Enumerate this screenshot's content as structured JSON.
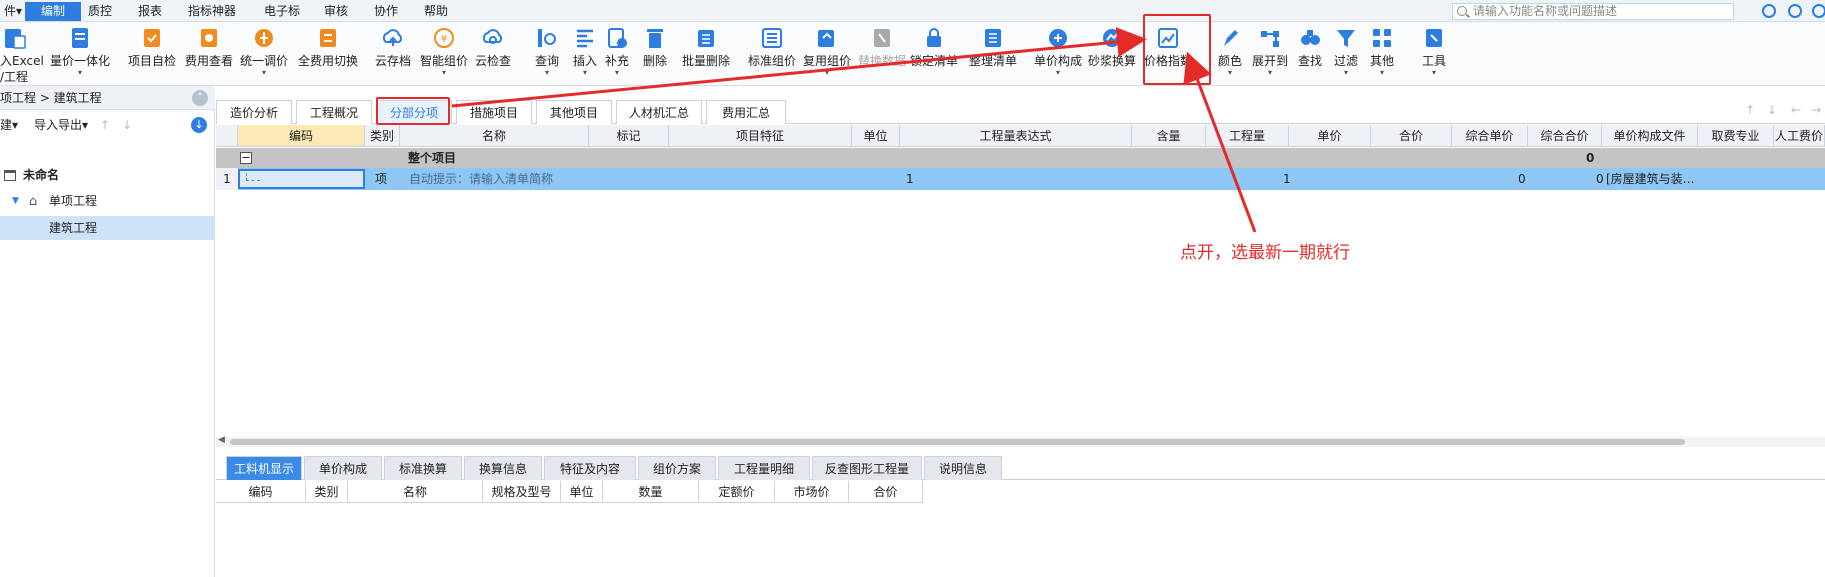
{
  "menu": {
    "items": [
      "件▾",
      "编制",
      "质控",
      "报表",
      "指标神器",
      "电子标",
      "审核",
      "协作",
      "帮助"
    ],
    "active": "编制"
  },
  "search": {
    "placeholder": "请输入功能名称或问题描述"
  },
  "toolbar": {
    "buttons": [
      {
        "label": "入Excel",
        "label2": "/工程",
        "icon": "import-icon",
        "color": "#2e7de0"
      },
      {
        "label": "量价一体化",
        "icon": "integration-icon",
        "color": "#2e7de0"
      },
      {
        "label": "项目自检",
        "icon": "check-icon",
        "color": "#f08c1e"
      },
      {
        "label": "费用查看",
        "icon": "fee-view-icon",
        "color": "#f08c1e"
      },
      {
        "label": "统一调价",
        "icon": "price-adjust-icon",
        "color": "#f08c1e"
      },
      {
        "label": "全费用切换",
        "icon": "switch-icon",
        "color": "#f08c1e"
      },
      {
        "label": "云存档",
        "icon": "cloud-save-icon",
        "color": "#2e7de0"
      },
      {
        "label": "智能组价",
        "icon": "smart-price-icon",
        "color": "#f08c1e"
      },
      {
        "label": "云检查",
        "icon": "cloud-check-icon",
        "color": "#2e7de0"
      },
      {
        "label": "查询",
        "icon": "query-icon",
        "color": "#2e7de0"
      },
      {
        "label": "插入",
        "icon": "insert-icon",
        "color": "#2e7de0"
      },
      {
        "label": "补充",
        "icon": "supplement-icon",
        "color": "#2e7de0"
      },
      {
        "label": "删除",
        "icon": "delete-icon",
        "color": "#2e7de0"
      },
      {
        "label": "批量删除",
        "icon": "batch-delete-icon",
        "color": "#2e7de0"
      },
      {
        "label": "标准组价",
        "icon": "standard-price-icon",
        "color": "#2e7de0"
      },
      {
        "label": "复用组价",
        "icon": "reuse-price-icon",
        "color": "#2e7de0"
      },
      {
        "label": "替换数据",
        "icon": "replace-icon",
        "color": "#aaaaaa"
      },
      {
        "label": "锁定清单",
        "icon": "lock-icon",
        "color": "#2e7de0"
      },
      {
        "label": "整理清单",
        "icon": "organize-icon",
        "color": "#2e7de0"
      },
      {
        "label": "单价构成",
        "icon": "unit-price-icon",
        "color": "#2e7de0"
      },
      {
        "label": "砂浆换算",
        "icon": "mortar-icon",
        "color": "#2e7de0"
      },
      {
        "label": "价格指数",
        "icon": "price-index-icon",
        "color": "#2e7de0"
      },
      {
        "label": "颜色",
        "icon": "color-icon",
        "color": "#2e7de0"
      },
      {
        "label": "展开到",
        "icon": "expand-icon",
        "color": "#2e7de0"
      },
      {
        "label": "查找",
        "icon": "find-icon",
        "color": "#2e7de0"
      },
      {
        "label": "过滤",
        "icon": "filter-icon",
        "color": "#2e7de0"
      },
      {
        "label": "其他",
        "icon": "other-icon",
        "color": "#2e7de0"
      },
      {
        "label": "工具",
        "icon": "tool-icon",
        "color": "#2e7de0"
      }
    ]
  },
  "left": {
    "breadcrumb": "项工程 > 建筑工程",
    "toolbar_new": "建▾",
    "toolbar_io": "导入导出▾",
    "tree": [
      "未命名",
      "单项工程",
      "建筑工程"
    ]
  },
  "tabs": [
    "造价分析",
    "工程概况",
    "分部分项",
    "措施项目",
    "其他项目",
    "人材机汇总",
    "费用汇总"
  ],
  "active_tab": "分部分项",
  "grid": {
    "headers": [
      "编码",
      "类别",
      "名称",
      "标记",
      "项目特征",
      "单位",
      "工程量表达式",
      "含量",
      "工程量",
      "单价",
      "合价",
      "综合单价",
      "综合合价",
      "单价构成文件",
      "取费专业",
      "人工费价"
    ],
    "row_total": {
      "name": "整个项目",
      "sum": "0"
    },
    "row1": {
      "index": "1",
      "type": "项",
      "name": "自动提示：请输入清单简称",
      "expr": "1",
      "quantity": "1",
      "unit_total": "0",
      "total": "0",
      "price_file": "[房屋建筑与装…"
    }
  },
  "bottom": {
    "tabs": [
      "工料机显示",
      "单价构成",
      "标准换算",
      "换算信息",
      "特征及内容",
      "组价方案",
      "工程量明细",
      "反查图形工程量",
      "说明信息"
    ],
    "active_tab": "工料机显示",
    "headers": [
      "编码",
      "类别",
      "名称",
      "规格及型号",
      "单位",
      "数量",
      "定额价",
      "市场价",
      "合价"
    ]
  },
  "annotation": "点开，选最新一期就行",
  "colors": {
    "accent": "#2e7de0",
    "annotation_red": "#e52a2a",
    "selected_row": "#8ec6f4"
  }
}
